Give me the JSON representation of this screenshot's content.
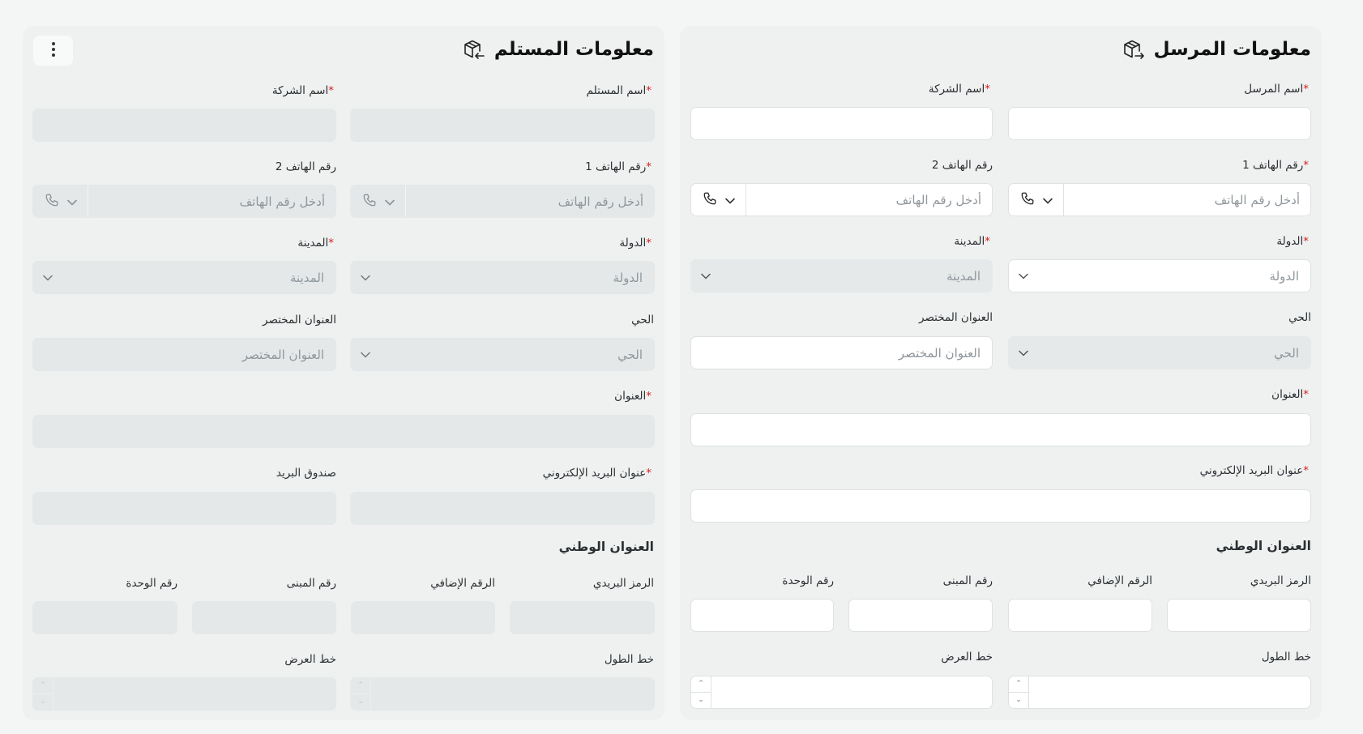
{
  "sender": {
    "title": "معلومات المرسل",
    "title_icon": "package-send-icon",
    "sender_name_label": "اسم المرسل",
    "company_name_label": "اسم الشركة",
    "phone1_label": "رقم الهاتف 1",
    "phone2_label": "رقم الهاتف 2",
    "phone_placeholder": "أدخل رقم الهاتف",
    "country_label": "الدولة",
    "country_placeholder": "الدولة",
    "city_label": "المدينة",
    "city_placeholder": "المدينة",
    "district_label": "الحي",
    "district_placeholder": "الحي",
    "short_address_label": "العنوان المختصر",
    "short_address_placeholder": "العنوان المختصر",
    "address_label": "العنوان",
    "email_label": "عنوان البريد الإلكتروني",
    "national_address_title": "العنوان الوطني",
    "postal_code_label": "الرمز البريدي",
    "additional_number_label": "الرقم الإضافي",
    "building_number_label": "رقم المبنى",
    "unit_number_label": "رقم الوحدة",
    "longitude_label": "خط الطول",
    "latitude_label": "خط العرض"
  },
  "receiver": {
    "title": "معلومات المستلم",
    "title_icon": "package-receive-icon",
    "receiver_name_label": "اسم المستلم",
    "company_name_label": "اسم الشركة",
    "phone1_label": "رقم الهاتف 1",
    "phone2_label": "رقم الهاتف 2",
    "phone_placeholder": "أدخل رقم الهاتف",
    "country_label": "الدولة",
    "country_placeholder": "الدولة",
    "city_label": "المدينة",
    "city_placeholder": "المدينة",
    "district_label": "الحي",
    "district_placeholder": "الحي",
    "short_address_label": "العنوان المختصر",
    "short_address_placeholder": "العنوان المختصر",
    "address_label": "العنوان",
    "email_label": "عنوان البريد الإلكتروني",
    "po_box_label": "صندوق البريد",
    "national_address_title": "العنوان الوطني",
    "postal_code_label": "الرمز البريدي",
    "additional_number_label": "الرقم الإضافي",
    "building_number_label": "رقم المبنى",
    "unit_number_label": "رقم الوحدة",
    "longitude_label": "خط الطول",
    "latitude_label": "خط العرض"
  },
  "required_mark": "*",
  "spin_up": "⌃",
  "spin_down": "⌄",
  "colors": {
    "required": "#d61f1f",
    "panel_bg": "#eff1f0",
    "input_bg": "#ffffff",
    "disabled_bg": "#e4e8e9"
  }
}
